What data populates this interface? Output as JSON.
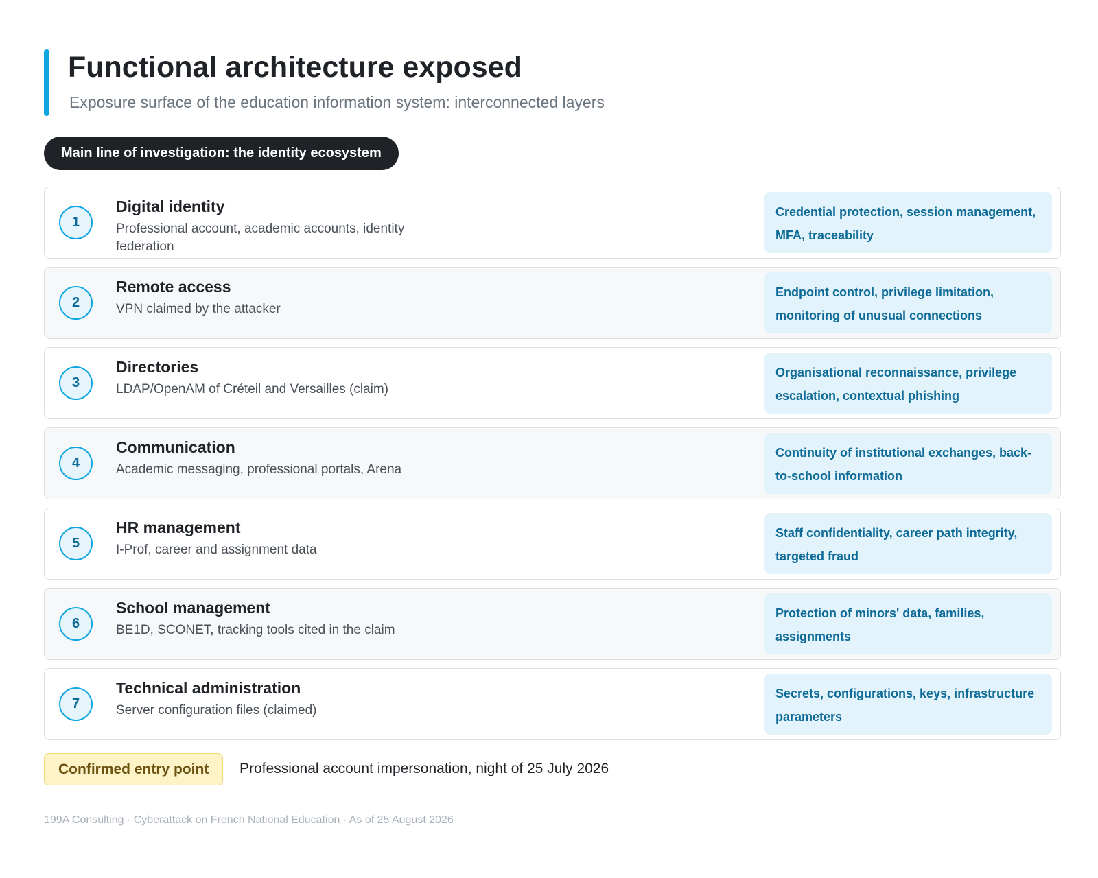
{
  "header": {
    "title": "Functional architecture exposed",
    "subtitle": "Exposure surface of the education information system: interconnected layers"
  },
  "section_label": "Main line of investigation: the identity ecosystem",
  "layers": [
    {
      "number": "1",
      "title": "Digital identity",
      "description": "Professional account, academic accounts, identity federation",
      "issues": "Credential protection, session management, MFA, traceability"
    },
    {
      "number": "2",
      "title": "Remote access",
      "description": "VPN claimed by the attacker",
      "issues": "Endpoint control, privilege limitation, monitoring of unusual connections"
    },
    {
      "number": "3",
      "title": "Directories",
      "description": "LDAP/OpenAM of Créteil and Versailles (claim)",
      "issues": "Organisational reconnaissance, privilege escalation, contextual phishing"
    },
    {
      "number": "4",
      "title": "Communication",
      "description": "Academic messaging, professional portals, Arena",
      "issues": "Continuity of institutional exchanges, back-to-school information"
    },
    {
      "number": "5",
      "title": "HR management",
      "description": "I-Prof, career and assignment data",
      "issues": "Staff confidentiality, career path integrity, targeted fraud"
    },
    {
      "number": "6",
      "title": "School management",
      "description": "BE1D, SCONET, tracking tools cited in the claim",
      "issues": "Protection of minors' data, families, assignments"
    },
    {
      "number": "7",
      "title": "Technical administration",
      "description": "Server configuration files (claimed)",
      "issues": "Secrets, configurations, keys, infrastructure parameters"
    }
  ],
  "entry_point": {
    "badge": "Confirmed entry point",
    "text": "Professional account impersonation, night of 25 July 2026"
  },
  "footer": "199A Consulting · Cyberattack on French National Education · As of 25 August 2026",
  "colors": {
    "accent": "#0ea5e0",
    "issue_text": "#0e6a96",
    "issue_background": "#e3f3fb",
    "pill_background": "#1f2328",
    "entry_badge_background": "#fdf3c6"
  }
}
